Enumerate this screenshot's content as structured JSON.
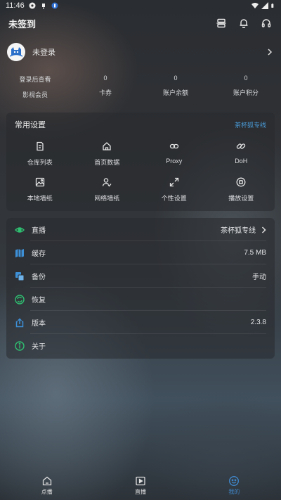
{
  "status_bar": {
    "time": "11:46"
  },
  "header": {
    "title": "未签到",
    "icons": [
      "scan-icon",
      "bell-icon",
      "headphones-icon"
    ]
  },
  "user": {
    "name": "未登录"
  },
  "stats": [
    {
      "label": "影视会员",
      "value": "登录后查看"
    },
    {
      "label": "卡券",
      "value": "0"
    },
    {
      "label": "账户余额",
      "value": "0"
    },
    {
      "label": "账户积分",
      "value": "0"
    }
  ],
  "settings": {
    "title": "常用设置",
    "link": "茶杯狐专线",
    "items": [
      {
        "label": "仓库列表",
        "icon": "document-list-icon"
      },
      {
        "label": "首页数据",
        "icon": "home-icon"
      },
      {
        "label": "Proxy",
        "icon": "link-icon"
      },
      {
        "label": "DoH",
        "icon": "chain-icon"
      },
      {
        "label": "本地墙纸",
        "icon": "image-icon"
      },
      {
        "label": "网络墙纸",
        "icon": "user-check-icon"
      },
      {
        "label": "个性设置",
        "icon": "expand-icon"
      },
      {
        "label": "播放设置",
        "icon": "stop-circle-icon"
      }
    ]
  },
  "list": [
    {
      "label": "直播",
      "value": "茶杯狐专线",
      "icon": "eye-icon",
      "color": "#2fbf71",
      "chevron": true
    },
    {
      "label": "缓存",
      "value": "7.5 MB",
      "icon": "map-icon",
      "color": "#3d8fd6",
      "chevron": false
    },
    {
      "label": "备份",
      "value": "手动",
      "icon": "copy-icon",
      "color": "#3d8fd6",
      "chevron": false
    },
    {
      "label": "恢复",
      "value": "",
      "icon": "refresh-icon",
      "color": "#2fbf71",
      "chevron": false
    },
    {
      "label": "版本",
      "value": "2.3.8",
      "icon": "share-icon",
      "color": "#3d8fd6",
      "chevron": false
    },
    {
      "label": "关于",
      "value": "",
      "icon": "info-icon",
      "color": "#2fbf71",
      "chevron": false
    }
  ],
  "bottom_nav": [
    {
      "label": "点播",
      "icon": "home-icon",
      "active": false
    },
    {
      "label": "直播",
      "icon": "play-icon",
      "active": false
    },
    {
      "label": "我的",
      "icon": "smile-icon",
      "active": true
    }
  ],
  "colors": {
    "accent": "#3f86c9",
    "green": "#2fbf71",
    "link": "#4a9bd8"
  }
}
